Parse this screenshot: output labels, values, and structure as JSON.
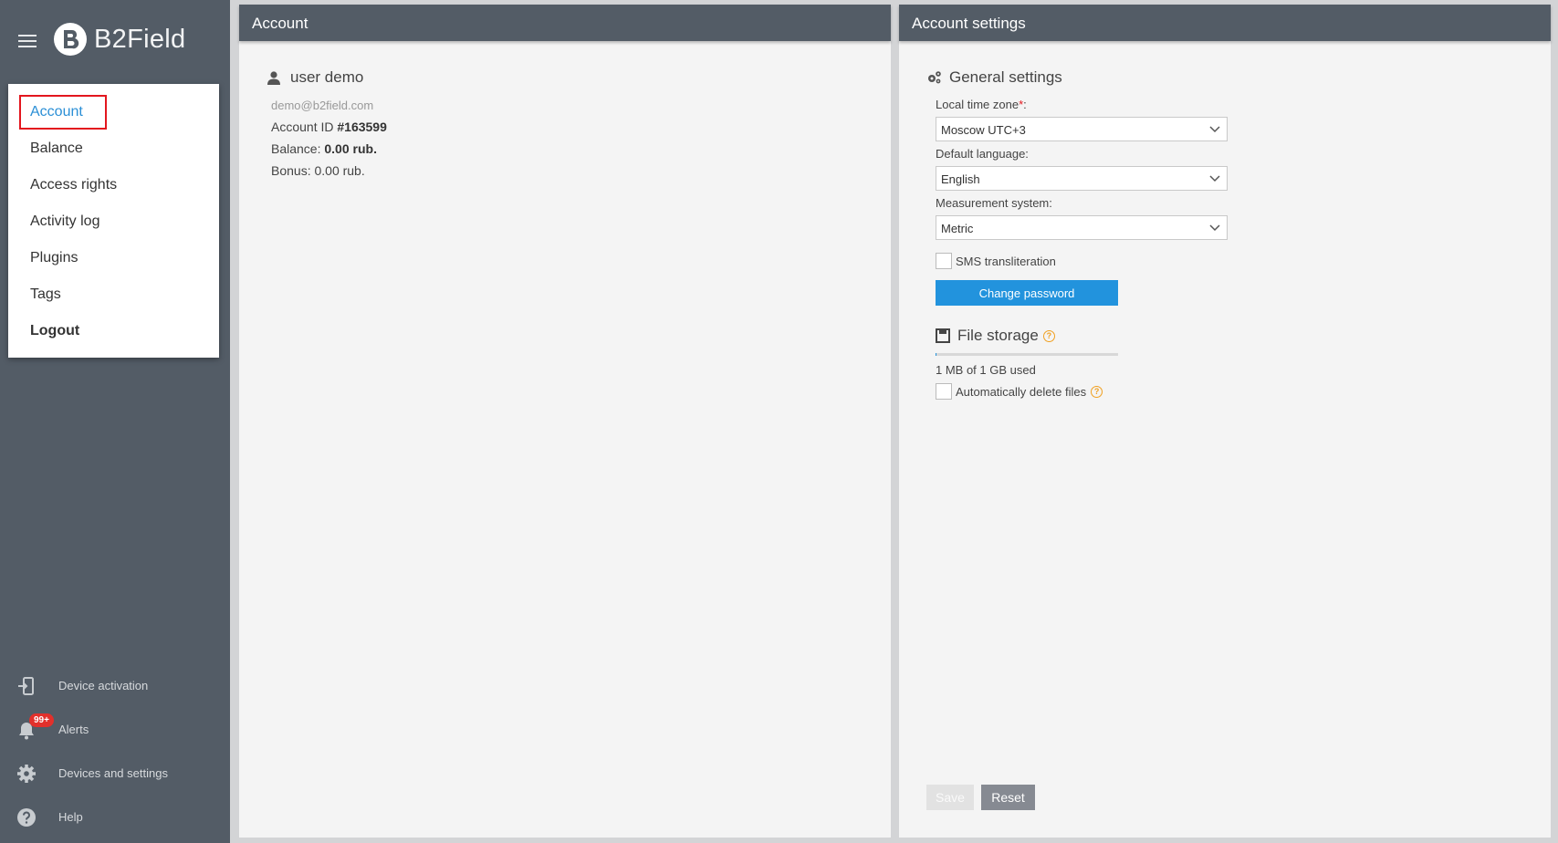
{
  "brand": {
    "name": "B2Field"
  },
  "menu": {
    "items": [
      {
        "label": "Account"
      },
      {
        "label": "Balance"
      },
      {
        "label": "Access rights"
      },
      {
        "label": "Activity log"
      },
      {
        "label": "Plugins"
      },
      {
        "label": "Tags"
      },
      {
        "label": "Logout"
      }
    ]
  },
  "sidebar_bottom": {
    "device_activation": "Device activation",
    "alerts": "Alerts",
    "alerts_badge": "99+",
    "devices_settings": "Devices and settings",
    "help": "Help"
  },
  "account": {
    "title": "Account",
    "username": "user demo",
    "email": "demo@b2field.com",
    "id_label": "Account ID",
    "id_value": "#163599",
    "balance_label": "Balance:",
    "balance_value": "0.00 rub.",
    "bonus_text": "Bonus: 0.00 rub."
  },
  "settings": {
    "title": "Account settings",
    "general_title": "General settings",
    "timezone_label": "Local time zone",
    "timezone_required": "*",
    "timezone_colon": ":",
    "timezone_value": "Moscow UTC+3",
    "language_label": "Default language:",
    "language_value": "English",
    "measurement_label": "Measurement system:",
    "measurement_value": "Metric",
    "sms_label": "SMS transliteration",
    "change_password": "Change password",
    "storage_title": "File storage",
    "storage_used_fraction": 0.001,
    "storage_text": "1 MB of 1 GB used",
    "auto_delete_label": "Automatically delete files",
    "save": "Save",
    "reset": "Reset"
  },
  "colors": {
    "sidebar": "#535c66",
    "accent": "#2293dd",
    "highlight_box": "#e3161e",
    "badge": "#e2302b",
    "help_icon": "#f0a020"
  }
}
